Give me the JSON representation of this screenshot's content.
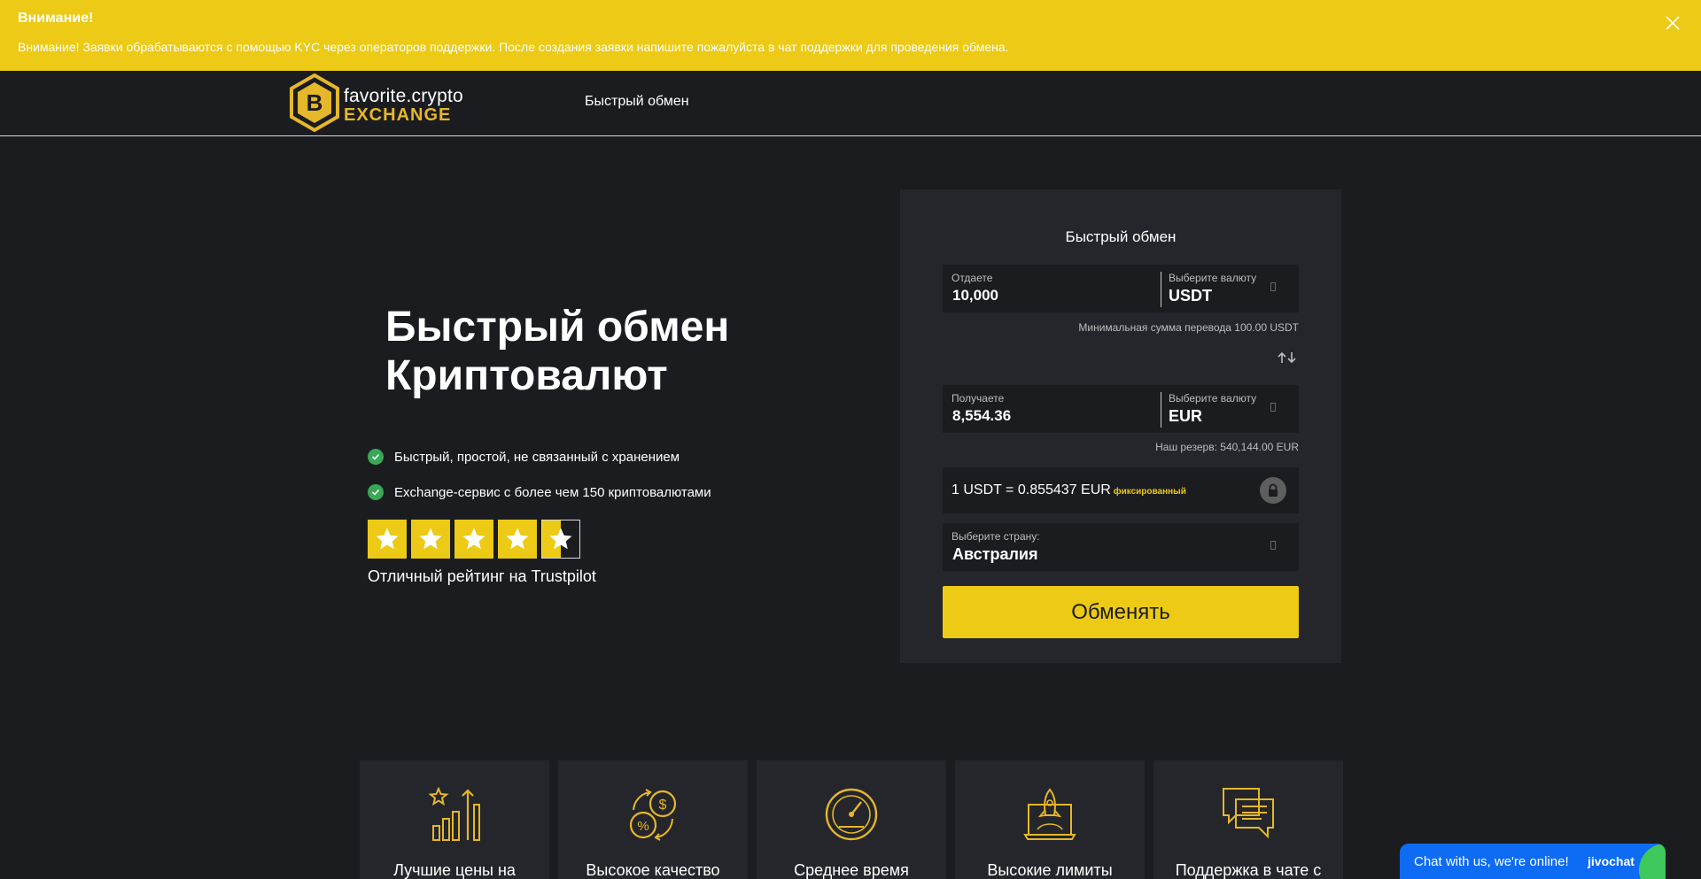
{
  "alert": {
    "title": "Внимание!",
    "text": "Внимание! Заявки обрабатываются с помощью KYC через операторов поддержки. После создания заявки напишите пожалуйста в чат поддержки для проведения обмена."
  },
  "header": {
    "logo_line1": "favorite.crypto",
    "logo_line2": "EXCHANGE",
    "nav_link": "Быстрый обмен"
  },
  "hero": {
    "title_line1": "Быстрый обмен",
    "title_line2": "Криптовалют",
    "features": [
      "Быстрый, простой, не связанный с хранением",
      "Exchange-сервис с более чем 150 криптовалютами"
    ],
    "rating": 4.5,
    "rating_text": "Отличный рейтинг на Trustpilot"
  },
  "exchange": {
    "title": "Быстрый обмен",
    "give": {
      "label": "Отдаете",
      "value": "10,000",
      "currency_label": "Выберите валюту",
      "currency": "USDT"
    },
    "min_hint": "Минимальная сумма перевода 100.00 USDT",
    "receive": {
      "label": "Получаете",
      "value": "8,554.36",
      "currency_label": "Выберите валюту",
      "currency": "EUR"
    },
    "reserve_hint": "Наш резерв: 540,144.00 EUR",
    "rate_text": "1 USDT = 0.855437 EUR",
    "rate_badge": "фиксированный",
    "country_label": "Выберите страну:",
    "country": "Австралия",
    "button": "Обменять"
  },
  "cards": [
    {
      "title": "Лучшие цены на",
      "icon": "chart-growth-icon"
    },
    {
      "title": "Высокое качество",
      "icon": "currency-exchange-icon"
    },
    {
      "title": "Среднее время",
      "icon": "speedometer-icon"
    },
    {
      "title": "Высокие лимиты",
      "icon": "rocket-laptop-icon"
    },
    {
      "title": "Поддержка в чате с",
      "icon": "chat-support-icon"
    }
  ],
  "chat": {
    "text": "Chat with us, we're online!",
    "brand": "jivochat"
  },
  "colors": {
    "accent": "#ecca16",
    "background": "#1b1c20",
    "panel": "#24262b",
    "success": "#3aa756",
    "chat": "#0d6bf4"
  }
}
